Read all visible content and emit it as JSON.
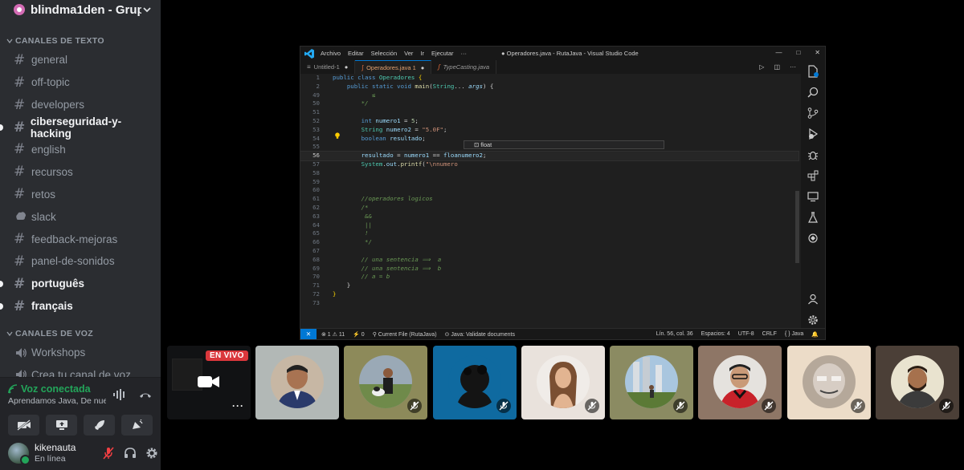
{
  "server": {
    "name": "blindma1den - Grupo ..."
  },
  "text_category": "CANALES DE TEXTO",
  "text_channels": [
    {
      "name": "general",
      "unread": false,
      "icon": "hash-icon"
    },
    {
      "name": "off-topic",
      "unread": false,
      "icon": "hash-icon"
    },
    {
      "name": "developers",
      "unread": false,
      "icon": "hash-icon"
    },
    {
      "name": "ciberseguridad-y-hacking",
      "unread": true,
      "icon": "hash-icon"
    },
    {
      "name": "english",
      "unread": false,
      "icon": "hash-icon"
    },
    {
      "name": "recursos",
      "unread": false,
      "icon": "hash-icon"
    },
    {
      "name": "retos",
      "unread": false,
      "icon": "hash-icon"
    },
    {
      "name": "slack",
      "unread": false,
      "icon": "slack-icon"
    },
    {
      "name": "feedback-mejoras",
      "unread": false,
      "icon": "hash-icon"
    },
    {
      "name": "panel-de-sonidos",
      "unread": false,
      "icon": "hash-icon"
    },
    {
      "name": "português",
      "unread": true,
      "icon": "hash-icon"
    },
    {
      "name": "français",
      "unread": true,
      "icon": "hash-icon"
    }
  ],
  "voice_category": "CANALES DE VOZ",
  "voice_channels": [
    {
      "name": "Workshops",
      "icon": "speaker-icon"
    },
    {
      "name": "Crea tu canal de voz",
      "icon": "speaker-icon"
    }
  ],
  "voice_connection": {
    "title": "Voz conectada",
    "subtitle": "Aprendamos Java, De nuev..."
  },
  "user": {
    "name": "kikenauta",
    "status": "En línea"
  },
  "vscode": {
    "menu": [
      "Archivo",
      "Editar",
      "Selección",
      "Ver",
      "Ir",
      "Ejecutar"
    ],
    "more_menu": "···",
    "window_title": "● Operadores.java - RutaJava - Visual Studio Code",
    "tabs": [
      {
        "label": "Untitled-1",
        "marker": "●",
        "active": false,
        "italic": false
      },
      {
        "label": "Operadores.java 1",
        "marker": "●",
        "active": true,
        "italic": false
      },
      {
        "label": "TypeCasting.java",
        "marker": "",
        "active": false,
        "italic": true
      }
    ],
    "lines": [
      {
        "n": "1",
        "html": "<span class='ty'>public</span> <span class='ty'>class</span> <span class='cls'>Operadores</span> <span class='gold'>{</span>"
      },
      {
        "n": "2",
        "html": "    <span class='ty'>public</span> <span class='ty'>static</span> <span class='ty'>void</span> <span class='nm'>main</span>(<span class='cls'>String</span>... <span class='prm'>args</span>) {"
      },
      {
        "n": "49",
        "html": "        <span class='com'>   ≤</span>"
      },
      {
        "n": "50",
        "html": "        <span class='com'>*/</span>"
      },
      {
        "n": "51",
        "html": ""
      },
      {
        "n": "52",
        "html": "        <span class='ty'>int</span> <span class='var'>numero1</span> = <span class='num'>5</span>;"
      },
      {
        "n": "53",
        "html": "        <span class='cls'>String</span> <span class='var'>numero2</span> = <span class='str'>\"5.0F\"</span>;"
      },
      {
        "n": "54",
        "html": "        <span class='ty'>boolean</span> <span class='var'>resultado</span>;"
      },
      {
        "n": "55",
        "html": ""
      },
      {
        "n": "56",
        "html": "        <span class='var'>resultado</span> = <span class='var'>numero1</span> == <span class='var'>floa</span><span class='var'>numero2</span>;",
        "cur": true
      },
      {
        "n": "57",
        "html": "        <span class='cls'>System</span>.<span class='var'>out</span>.<span class='nm'>printf</span>(<span class='str'>\"\\nnumero</span>"
      },
      {
        "n": "58",
        "html": ""
      },
      {
        "n": "59",
        "html": ""
      },
      {
        "n": "60",
        "html": ""
      },
      {
        "n": "61",
        "html": "        <span class='com'>//operadores logicos</span>"
      },
      {
        "n": "62",
        "html": "        <span class='com'>/*</span>"
      },
      {
        "n": "63",
        "html": "        <span class='com'> &amp;&amp;</span>"
      },
      {
        "n": "64",
        "html": "        <span class='com'> ||</span>"
      },
      {
        "n": "65",
        "html": "        <span class='com'> !</span>"
      },
      {
        "n": "66",
        "html": "        <span class='com'> */</span>"
      },
      {
        "n": "67",
        "html": ""
      },
      {
        "n": "68",
        "html": "        <span class='com'>// una sentencia ⟹  a</span>"
      },
      {
        "n": "69",
        "html": "        <span class='com'>// una sentencia ⟹  b</span>"
      },
      {
        "n": "70",
        "html": "        <span class='com'>// a = b</span>"
      },
      {
        "n": "71",
        "html": "    }"
      },
      {
        "n": "72",
        "html": "<span class='gold'>}</span>"
      },
      {
        "n": "73",
        "html": ""
      }
    ],
    "suggestion": "⊡ float",
    "status": {
      "errors": "⊗ 1 ⚠ 11",
      "ports": "⚡ 0",
      "current_file": "⚲ Current File (RutaJava)",
      "java": "⊙ Java: Validate documents",
      "position": "Lín. 56, col. 36",
      "spaces": "Espacios: 4",
      "encoding": "UTF-8",
      "eol": "CRLF",
      "lang": "{ } Java"
    }
  },
  "stream_tile": {
    "badge": "EN VIVO"
  },
  "participants": [
    {
      "id": "p1",
      "bg": "#b2b8b6",
      "muted": false
    },
    {
      "id": "p2",
      "bg": "#8d8a5a",
      "muted": true
    },
    {
      "id": "p3",
      "bg": "#0f6aa0",
      "muted": true
    },
    {
      "id": "p4",
      "bg": "#e9e2dc",
      "muted": true
    },
    {
      "id": "p5",
      "bg": "#8b8b62",
      "muted": true
    },
    {
      "id": "p6",
      "bg": "#8e7666",
      "muted": true
    },
    {
      "id": "p7",
      "bg": "#ecdcc8",
      "muted": true
    },
    {
      "id": "p8",
      "bg": "#4b3f37",
      "muted": true
    }
  ]
}
